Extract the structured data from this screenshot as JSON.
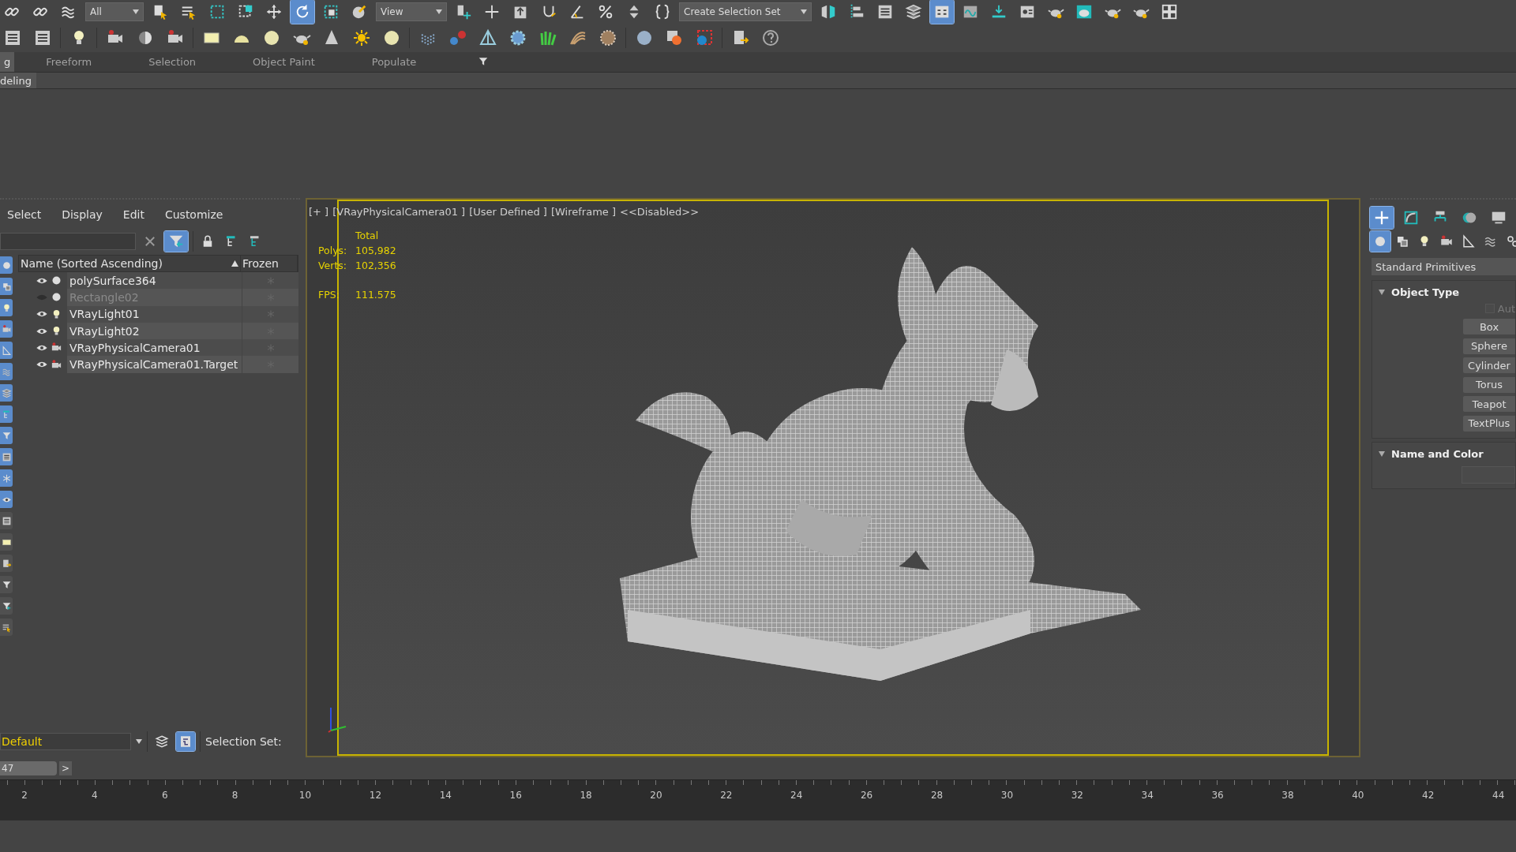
{
  "main_toolbar": {
    "items": [
      {
        "kind": "button",
        "selected": false
      },
      {
        "kind": "button",
        "selected": false
      },
      {
        "kind": "button",
        "selected": false
      },
      {
        "kind": "dropdown",
        "value": "All"
      },
      {
        "kind": "button",
        "selected": false
      },
      {
        "kind": "button",
        "selected": false
      },
      {
        "kind": "button",
        "selected": false
      },
      {
        "kind": "button",
        "selected": false
      },
      {
        "kind": "button",
        "selected": false
      },
      {
        "kind": "button",
        "selected": true
      },
      {
        "kind": "button",
        "selected": false
      },
      {
        "kind": "button",
        "selected": false
      },
      {
        "kind": "dropdown",
        "value": "View"
      },
      {
        "kind": "button",
        "selected": false
      },
      {
        "kind": "button",
        "selected": false
      },
      {
        "kind": "button",
        "selected": false
      },
      {
        "kind": "button",
        "selected": false
      },
      {
        "kind": "button",
        "selected": false
      },
      {
        "kind": "button",
        "selected": false
      },
      {
        "kind": "button",
        "selected": false
      },
      {
        "kind": "button",
        "selected": false
      },
      {
        "kind": "dropdown",
        "value": "Create Selection Set"
      },
      {
        "kind": "button",
        "selected": false
      },
      {
        "kind": "button",
        "selected": false
      },
      {
        "kind": "button",
        "selected": false
      },
      {
        "kind": "button",
        "selected": false
      },
      {
        "kind": "button",
        "selected": true
      },
      {
        "kind": "button",
        "selected": false
      },
      {
        "kind": "button",
        "selected": false
      },
      {
        "kind": "button",
        "selected": false
      },
      {
        "kind": "button",
        "selected": false
      },
      {
        "kind": "button",
        "selected": false
      },
      {
        "kind": "button",
        "selected": false
      },
      {
        "kind": "button",
        "selected": false
      },
      {
        "kind": "button",
        "selected": false
      }
    ]
  },
  "ribbon": {
    "tabs": [
      {
        "label": "g",
        "selected": true
      },
      {
        "label": "Freeform",
        "selected": false
      },
      {
        "label": "Selection",
        "selected": false
      },
      {
        "label": "Object Paint",
        "selected": false
      },
      {
        "label": "Populate",
        "selected": false
      }
    ],
    "panel_tab": "deling"
  },
  "scene_explorer": {
    "menu": [
      "Select",
      "Display",
      "Edit",
      "Customize"
    ],
    "filter_active": true,
    "filter_toggles": [
      {
        "on": true
      },
      {
        "on": true
      },
      {
        "on": true
      },
      {
        "on": true
      },
      {
        "on": true
      },
      {
        "on": true
      },
      {
        "on": true
      },
      {
        "on": true
      },
      {
        "on": true
      },
      {
        "on": true
      },
      {
        "on": true
      },
      {
        "on": true
      },
      {
        "on": false
      },
      {
        "on": false
      },
      {
        "on": false
      },
      {
        "on": false
      },
      {
        "on": false
      },
      {
        "on": false
      }
    ],
    "columns": [
      "Name (Sorted Ascending)",
      "Frozen"
    ],
    "rows": [
      {
        "name": "polySurface364",
        "kind": "geometry",
        "visible": true,
        "frozen": false
      },
      {
        "name": "Rectangle02",
        "kind": "geometry",
        "visible": false,
        "frozen": false
      },
      {
        "name": "VRayLight01",
        "kind": "light",
        "visible": true,
        "frozen": false
      },
      {
        "name": "VRayLight02",
        "kind": "light",
        "visible": true,
        "frozen": false
      },
      {
        "name": "VRayPhysicalCamera01",
        "kind": "camera",
        "visible": true,
        "frozen": false
      },
      {
        "name": "VRayPhysicalCamera01.Target",
        "kind": "camera",
        "visible": true,
        "frozen": false
      }
    ],
    "layer": "Default",
    "layer_explorer_active": true,
    "selection_set_label": "Selection Set:"
  },
  "viewport": {
    "label_parts": [
      "[+ ]",
      "[VRayPhysicalCamera01 ]",
      "[User Defined ]",
      "[Wireframe ]",
      "<<Disabled>>"
    ],
    "stats_header": "Total",
    "stat_groups": [
      [
        {
          "label": "Polys:",
          "value": "105,982"
        },
        {
          "label": "Verts:",
          "value": "102,356"
        }
      ],
      [
        {
          "label": "FPS:",
          "value": "111.575"
        }
      ]
    ],
    "content": {
      "kind": "picture"
    }
  },
  "command_panel": {
    "tabs": [
      {
        "selected": true
      },
      {
        "selected": false
      },
      {
        "selected": false
      },
      {
        "selected": false
      },
      {
        "selected": false
      }
    ],
    "categories": [
      {
        "selected": true
      },
      {
        "selected": false
      },
      {
        "selected": false
      },
      {
        "selected": false
      },
      {
        "selected": false
      },
      {
        "selected": false
      },
      {
        "selected": false
      }
    ],
    "type_dropdown": "Standard Primitives",
    "rollouts": [
      {
        "kind": "buttons",
        "title": "Object Type",
        "expanded": true,
        "checkbox": {
          "label": "Aut",
          "checked": false,
          "disabled": true
        },
        "buttons": [
          "Box",
          "Sphere",
          "Cylinder",
          "Torus",
          "Teapot",
          "TextPlus"
        ]
      },
      {
        "kind": "name_field",
        "title": "Name and Color",
        "expanded": true
      }
    ]
  },
  "time_slider": {
    "frame": "47",
    "next": ">"
  },
  "track_bar": {
    "ticks": [
      "2",
      "4",
      "6",
      "8",
      "10",
      "12",
      "14",
      "16",
      "18",
      "20",
      "22",
      "24",
      "26",
      "28",
      "30",
      "32",
      "34",
      "36",
      "38",
      "40",
      "42",
      "44"
    ]
  }
}
